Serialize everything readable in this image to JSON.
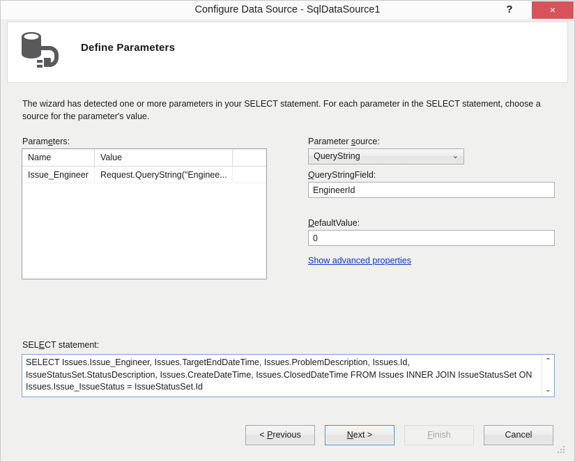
{
  "window": {
    "title": "Configure Data Source - SqlDataSource1",
    "help_label": "?",
    "close_label": "×",
    "close_color": "#d6535a"
  },
  "header": {
    "title": "Define Parameters",
    "icon": "database-plug-icon"
  },
  "body": {
    "intro": "The wizard has detected one or more parameters in your SELECT statement. For each parameter in the SELECT statement, choose a source for the parameter's value."
  },
  "parameters_panel": {
    "label_pre": "Param",
    "label_acc": "e",
    "label_post": "ters:",
    "grid": {
      "columns": [
        "Name",
        "Value",
        ""
      ],
      "rows": [
        {
          "name": "Issue_Engineer",
          "value": "Request.QueryString(\"Enginee...",
          "extra": ""
        }
      ]
    }
  },
  "source_panel": {
    "param_source": {
      "label_pre": "Parameter ",
      "label_acc": "s",
      "label_post": "ource:",
      "value": "QueryString",
      "arrow": "⌄",
      "options": [
        "QueryString"
      ]
    },
    "query_string_field": {
      "label_acc": "Q",
      "label_post": "ueryStringField:",
      "value": "EngineerId",
      "placeholder": ""
    },
    "default_value": {
      "label_acc": "D",
      "label_post": "efaultValue:",
      "value": "0",
      "placeholder": ""
    },
    "advanced_link": "Show advanced properties"
  },
  "select_panel": {
    "label_pre": "SEL",
    "label_acc": "E",
    "label_post": "CT statement:",
    "statement": "SELECT Issues.Issue_Engineer, Issues.TargetEndDateTime, Issues.ProblemDescription, Issues.Id, IssueStatusSet.StatusDescription, Issues.CreateDateTime, Issues.ClosedDateTime FROM Issues INNER JOIN IssueStatusSet ON Issues.Issue_IssueStatus = IssueStatusSet.Id",
    "scroll_up": "⌃",
    "scroll_down": "⌄"
  },
  "footer": {
    "previous": {
      "pre": "< ",
      "acc": "P",
      "post": "revious"
    },
    "next": {
      "pre": "",
      "acc": "N",
      "post": "ext >"
    },
    "finish": {
      "pre": "",
      "acc": "F",
      "post": "inish",
      "disabled": true
    },
    "cancel": {
      "pre": "",
      "acc": "",
      "post": "Cancel"
    }
  }
}
